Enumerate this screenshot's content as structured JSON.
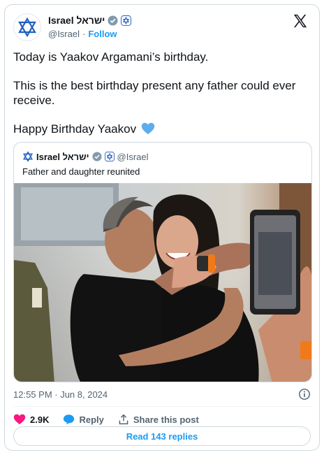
{
  "header": {
    "display_name": "Israel ישראל",
    "handle": "@Israel",
    "separator": "·",
    "follow_label": "Follow"
  },
  "tweet": {
    "lines": [
      "Today is Yaakov Argamani’s birthday.",
      "This is the best birthday present any father could ever receive.",
      "Happy Birthday Yaakov"
    ]
  },
  "quote": {
    "display_name": "Israel ישראל",
    "handle": "@Israel",
    "text": "Father and daughter reunited"
  },
  "meta": {
    "timestamp": "12:55 PM · Jun 8, 2024"
  },
  "actions": {
    "likes": "2.9K",
    "reply_label": "Reply",
    "share_label": "Share this post"
  },
  "read_replies_label": "Read 143 replies",
  "colors": {
    "accent": "#1d9bf0",
    "like": "#f91880",
    "verified": "#829aab"
  },
  "icons": [
    "star-of-david-icon",
    "verified-gray-icon",
    "flag-badge-icon",
    "x-logo-icon",
    "blue-heart-icon",
    "info-icon",
    "heart-icon",
    "reply-bubble-icon",
    "share-icon"
  ]
}
